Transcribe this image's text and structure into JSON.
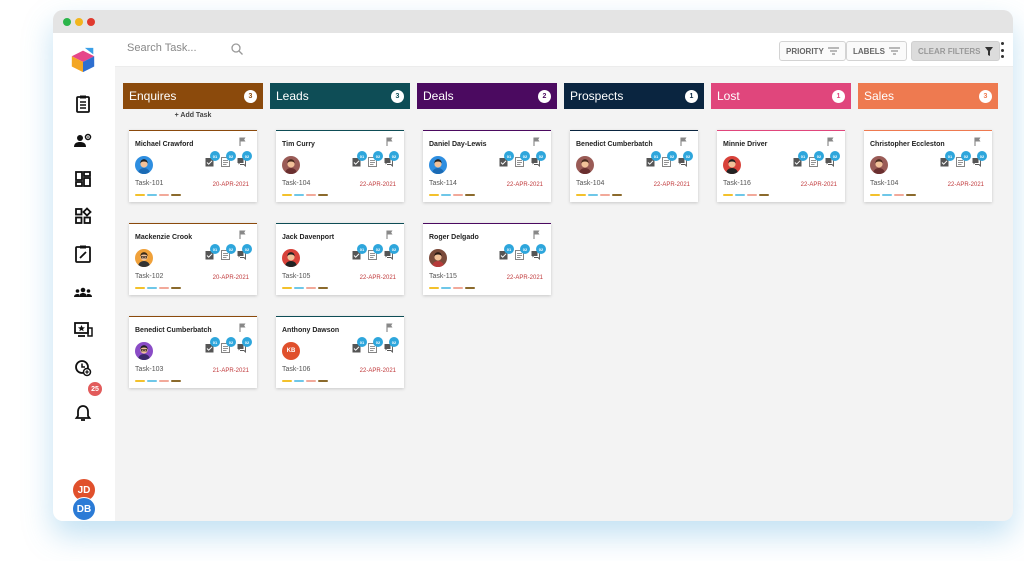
{
  "search": {
    "placeholder": "Search Task..."
  },
  "toolbar": {
    "priority_label": "PRIORITY",
    "labels_label": "LABELS",
    "clear_filters_label": "CLEAR FILTERS"
  },
  "sidebar": {
    "items": [
      {
        "icon": "logo-icon"
      },
      {
        "icon": "clipboard-icon"
      },
      {
        "icon": "users-gear-icon"
      },
      {
        "icon": "dashboard-icon"
      },
      {
        "icon": "apps-icon"
      },
      {
        "icon": "edit-task-icon"
      },
      {
        "icon": "team-icon"
      },
      {
        "icon": "screen-star-icon"
      },
      {
        "icon": "clock-plus-icon"
      },
      {
        "icon": "bell-icon"
      }
    ],
    "notification_count": "25",
    "users": [
      {
        "initials": "JD",
        "color": "#e0502c"
      },
      {
        "initials": "DB",
        "color": "#2b7bd6"
      }
    ]
  },
  "add_task_label": "+ Add Task",
  "label_colors": [
    "#f3c12c",
    "#6ec7e8",
    "#f2a99a",
    "#8b6a2c"
  ],
  "columns": [
    {
      "name": "Enquires",
      "count": "3",
      "color": "#8b4a0c",
      "cards": [
        {
          "name": "Michael Crawford",
          "task": "Task-101",
          "date": "20-APR-2021",
          "avatar": "man-blue-shirt",
          "accent": "#8b4a0c",
          "badges": [
            "01",
            "02",
            "02"
          ]
        },
        {
          "name": "Mackenzie Crook",
          "task": "Task-102",
          "date": "20-APR-2021",
          "avatar": "man-glasses",
          "accent": "#8b4a0c",
          "badges": [
            "01",
            "02",
            "02"
          ]
        },
        {
          "name": "Benedict Cumberbatch",
          "task": "Task-103",
          "date": "21-APR-2021",
          "avatar": "man-purple",
          "accent": "#8b4a0c",
          "badges": [
            "01",
            "02",
            "02"
          ]
        }
      ]
    },
    {
      "name": "Leads",
      "count": "3",
      "color": "#0e4d56",
      "cards": [
        {
          "name": "Tim Curry",
          "task": "Task-104",
          "date": "22-APR-2021",
          "avatar": "woman-brown",
          "accent": "#0e4d56",
          "badges": [
            "01",
            "02",
            "02"
          ]
        },
        {
          "name": "Jack Davenport",
          "task": "Task-105",
          "date": "22-APR-2021",
          "avatar": "man-red",
          "accent": "#0e4d56",
          "badges": [
            "01",
            "02",
            "02"
          ]
        },
        {
          "name": "Anthony Dawson",
          "task": "Task-106",
          "date": "22-APR-2021",
          "avatar": "initials",
          "initials": "KB",
          "accent": "#0e4d56",
          "badges": [
            "01",
            "02",
            "02"
          ]
        }
      ]
    },
    {
      "name": "Deals",
      "count": "2",
      "color": "#4b0a60",
      "cards": [
        {
          "name": "Daniel Day-Lewis",
          "task": "Task-114",
          "date": "22-APR-2021",
          "avatar": "man-blue-shirt",
          "accent": "#4b0a60",
          "badges": [
            "01",
            "02",
            "02"
          ]
        },
        {
          "name": "Roger Delgado",
          "task": "Task-115",
          "date": "22-APR-2021",
          "avatar": "woman-red",
          "accent": "#4b0a60",
          "badges": [
            "01",
            "02",
            "02"
          ]
        }
      ]
    },
    {
      "name": "Prospects",
      "count": "1",
      "color": "#0a2540",
      "cards": [
        {
          "name": "Benedict Cumberbatch",
          "task": "Task-104",
          "date": "22-APR-2021",
          "avatar": "woman-brown",
          "accent": "#0a2540",
          "badges": [
            "01",
            "02",
            "02"
          ]
        }
      ]
    },
    {
      "name": "Lost",
      "count": "1",
      "color": "#e0467c",
      "cards": [
        {
          "name": "Minnie Driver",
          "task": "Task-116",
          "date": "22-APR-2021",
          "avatar": "man-red",
          "accent": "#e0467c",
          "badges": [
            "01",
            "02",
            "02"
          ]
        }
      ]
    },
    {
      "name": "Sales",
      "count": "3",
      "color": "#ee7a50",
      "cards": [
        {
          "name": "Christopher Eccleston",
          "task": "Task-104",
          "date": "22-APR-2021",
          "avatar": "woman-brown",
          "accent": "#ee7a50",
          "badges": [
            "01",
            "02",
            "02"
          ]
        }
      ]
    }
  ]
}
